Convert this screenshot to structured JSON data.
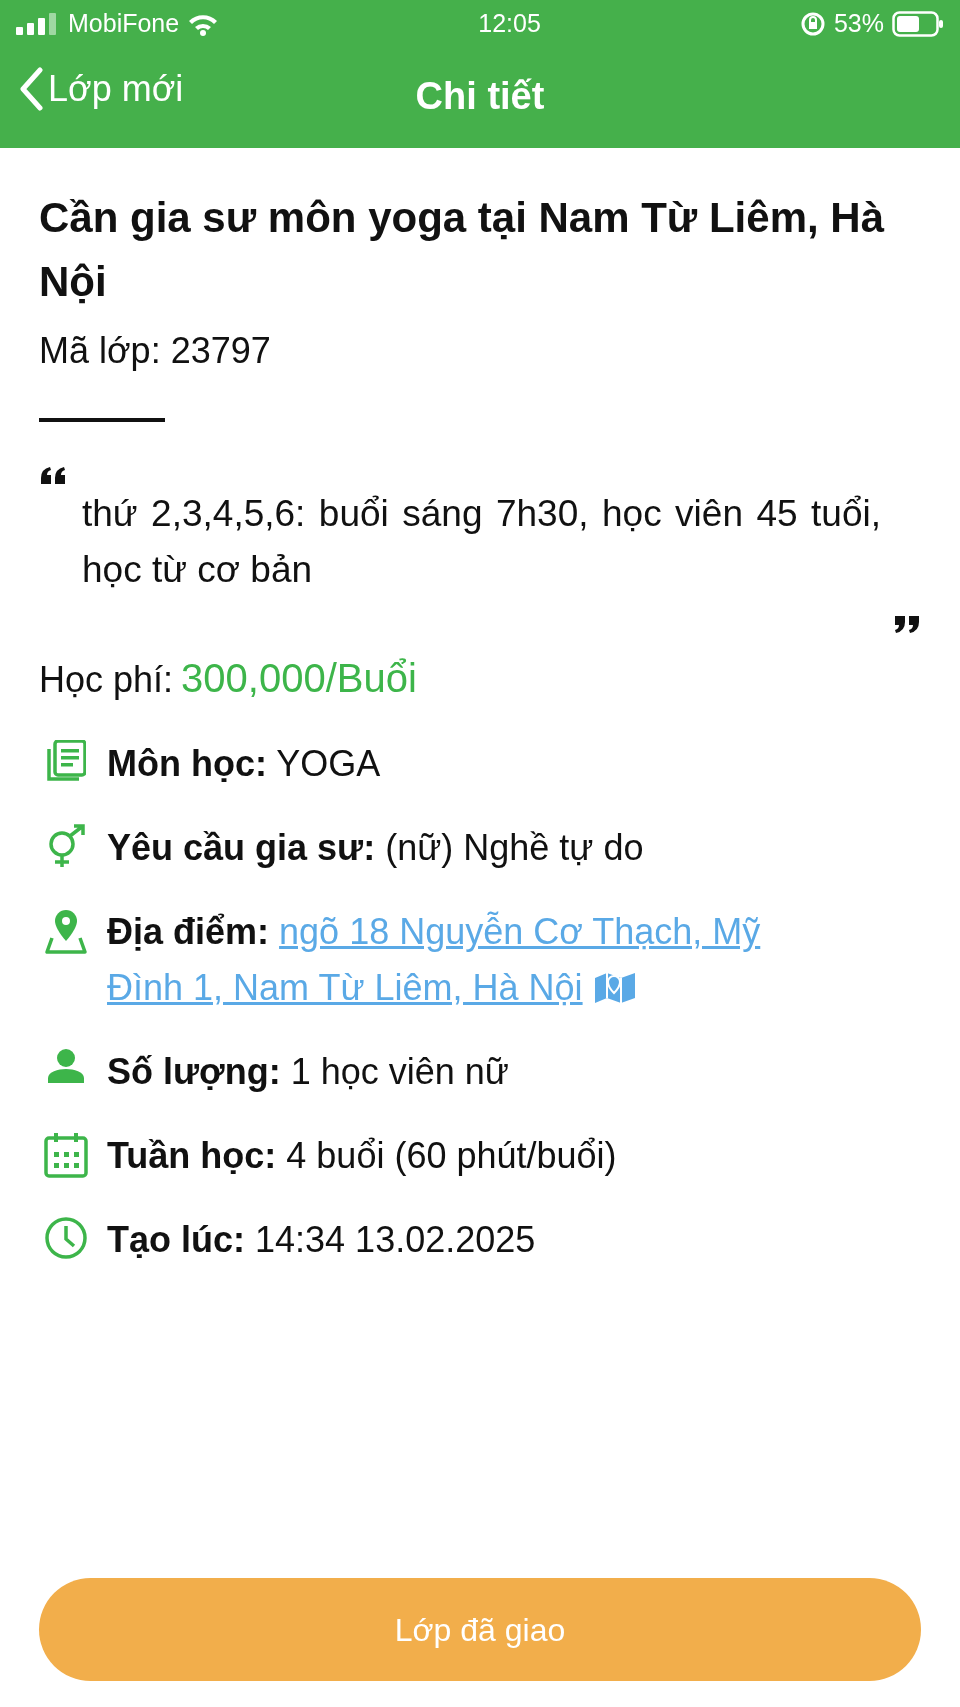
{
  "status_bar": {
    "carrier": "MobiFone",
    "time": "12:05",
    "battery": "53%"
  },
  "nav": {
    "back": "Lớp mới",
    "title": "Chi tiết"
  },
  "class": {
    "title": "Cần gia sư môn yoga tại Nam Từ Liêm, Hà Nội",
    "code": "Mã lớp: 23797",
    "note": "thứ 2,3,4,5,6: buổi sáng 7h30, học viên 45 tuổi, học từ cơ bản",
    "fee_label": "Học phí:",
    "fee": "300,000/Buổi"
  },
  "details": [
    {
      "kind": "text",
      "label": "Môn học:",
      "value": "YOGA"
    },
    {
      "kind": "text",
      "label": "Yêu cầu gia sư:",
      "value": "(nữ) Nghề tự do"
    },
    {
      "kind": "link",
      "label": "Địa điểm:",
      "lines": [
        "ngõ 18 Nguyễn Cơ Thạch, Mỹ",
        "Đình 1, Nam Từ Liêm, Hà Nội"
      ]
    },
    {
      "kind": "text",
      "label": "Số lượng:",
      "value": "1 học viên nữ"
    },
    {
      "kind": "text",
      "label": "Tuần học:",
      "value": "4 buổi (60 phút/buổi)"
    },
    {
      "kind": "text",
      "label": "Tạo lúc:",
      "value": "14:34 13.02.2025"
    }
  ],
  "button": "Lớp đã giao"
}
